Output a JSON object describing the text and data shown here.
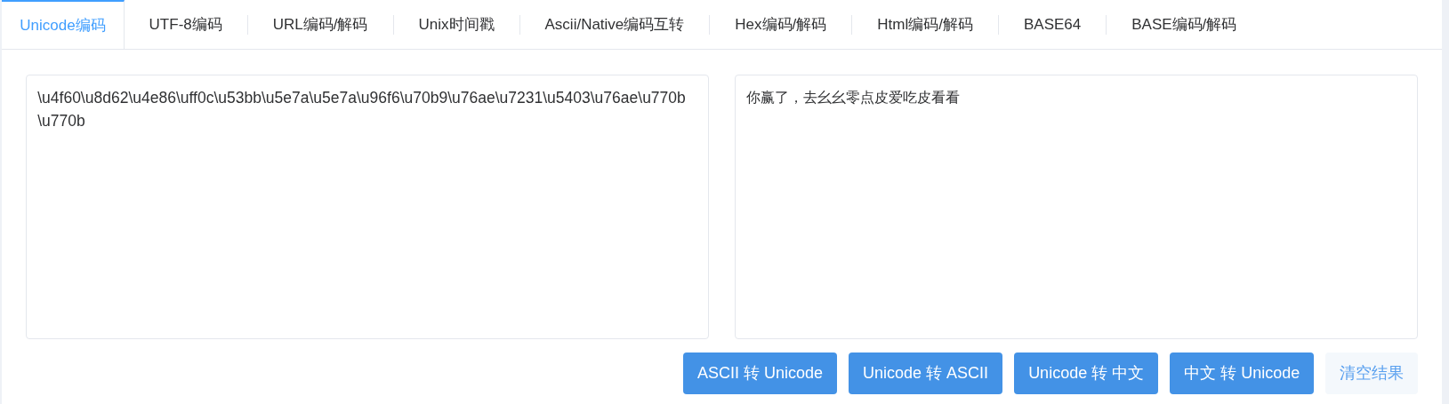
{
  "tabs": [
    {
      "label": "Unicode编码",
      "selected": true
    },
    {
      "label": "UTF-8编码",
      "selected": false
    },
    {
      "label": "URL编码/解码",
      "selected": false
    },
    {
      "label": "Unix时间戳",
      "selected": false
    },
    {
      "label": "Ascii/Native编码互转",
      "selected": false
    },
    {
      "label": "Hex编码/解码",
      "selected": false
    },
    {
      "label": "Html编码/解码",
      "selected": false
    },
    {
      "label": "BASE64",
      "selected": false
    },
    {
      "label": "BASE编码/解码",
      "selected": false
    }
  ],
  "input": {
    "value": "\\u4f60\\u8d62\\u4e86\\uff0c\\u53bb\\u5e7a\\u5e7a\\u96f6\\u70b9\\u76ae\\u7231\\u5403\\u76ae\\u770b\\u770b"
  },
  "output": {
    "value": "你赢了，去幺幺零点皮爱吃皮看看"
  },
  "buttons": [
    {
      "label": "ASCII 转 Unicode",
      "kind": "primary"
    },
    {
      "label": "Unicode 转 ASCII",
      "kind": "primary"
    },
    {
      "label": "Unicode 转 中文",
      "kind": "primary"
    },
    {
      "label": "中文 转 Unicode",
      "kind": "primary"
    },
    {
      "label": "清空结果",
      "kind": "plain"
    }
  ]
}
